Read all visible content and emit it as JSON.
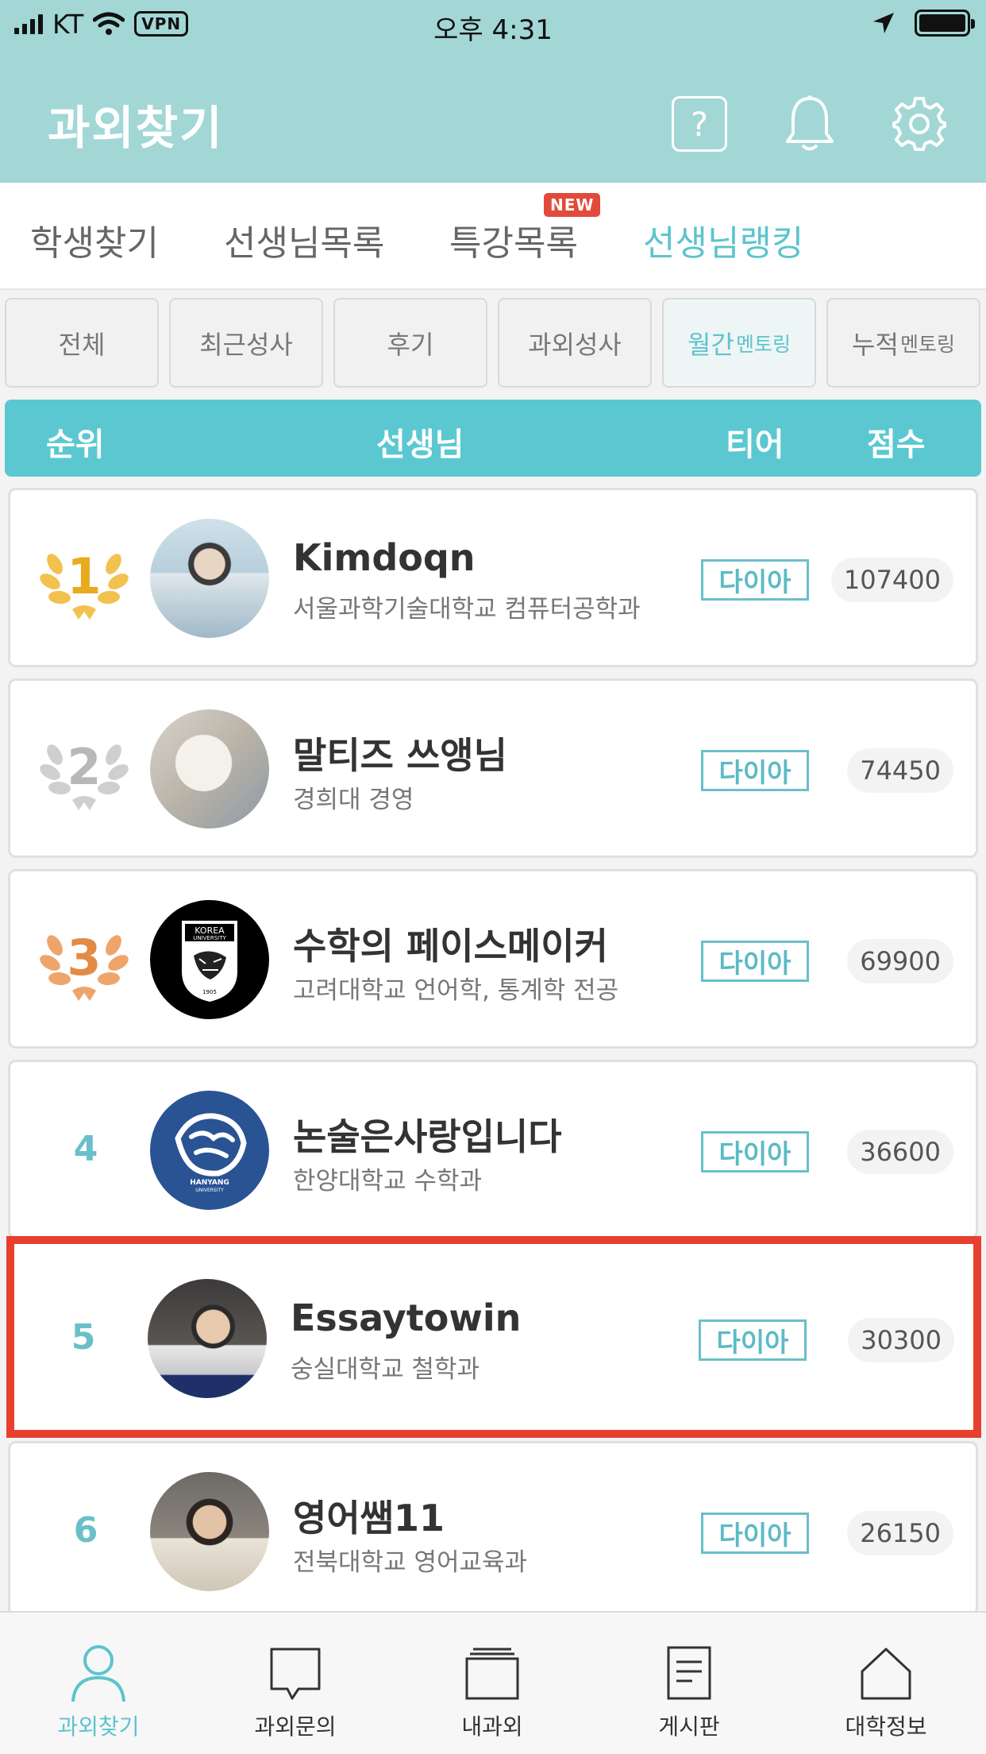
{
  "status_bar": {
    "carrier": "KT",
    "vpn": "VPN",
    "time": "오후 4:31"
  },
  "header": {
    "title": "과외찾기",
    "help_glyph": "?",
    "icons": [
      "help-icon",
      "bell-icon",
      "gear-icon"
    ]
  },
  "tabs": [
    {
      "label": "학생찾기"
    },
    {
      "label": "선생님목록"
    },
    {
      "label": "특강목록",
      "badge": "NEW"
    },
    {
      "label": "선생님랭킹",
      "active": true
    }
  ],
  "filters": [
    {
      "label": "전체",
      "suffix": ""
    },
    {
      "label": "최근성사",
      "suffix": ""
    },
    {
      "label": "후기",
      "suffix": ""
    },
    {
      "label": "과외성사",
      "suffix": ""
    },
    {
      "label": "월간",
      "suffix": "멘토링",
      "active": true
    },
    {
      "label": "누적",
      "suffix": "멘토링"
    }
  ],
  "ranking_header": {
    "rank": "순위",
    "teacher": "선생님",
    "tier": "티어",
    "score": "점수"
  },
  "rows": [
    {
      "rank": "1",
      "medal": "gold",
      "name": "Kimdoqn",
      "school": "서울과학기술대학교 컴퓨터공학과",
      "tier": "다이아",
      "score": "107400"
    },
    {
      "rank": "2",
      "medal": "silver",
      "name": "말티즈 쓰앵님",
      "school": "경희대 경영",
      "tier": "다이아",
      "score": "74450"
    },
    {
      "rank": "3",
      "medal": "bronze",
      "name": "수학의 페이스메이커",
      "school": "고려대학교 언어학, 통계학 전공",
      "tier": "다이아",
      "score": "69900"
    },
    {
      "rank": "4",
      "name": "논술은사랑입니다",
      "school": "한양대학교 수학과",
      "tier": "다이아",
      "score": "36600"
    },
    {
      "rank": "5",
      "name": "Essaytowin",
      "school": "숭실대학교 철학과",
      "tier": "다이아",
      "score": "30300",
      "highlighted": true
    },
    {
      "rank": "6",
      "name": "영어쌤11",
      "school": "전북대학교 영어교육과",
      "tier": "다이아",
      "score": "26150"
    }
  ],
  "logos": {
    "korea_text_1": "KOREA",
    "korea_text_2": "UNIVERSITY",
    "korea_year": "1905",
    "hanyang_text_1": "HANYANG",
    "hanyang_text_2": "UNIVERSITY"
  },
  "bottom_nav": [
    {
      "label": "과외찾기",
      "icon": "person-icon",
      "active": true
    },
    {
      "label": "과외문의",
      "icon": "chat-bubble-icon"
    },
    {
      "label": "내과외",
      "icon": "folder-stack-icon"
    },
    {
      "label": "게시판",
      "icon": "document-icon"
    },
    {
      "label": "대학정보",
      "icon": "home-icon"
    }
  ],
  "colors": {
    "header_bg": "#a2d7d6",
    "accent": "#5cc4ce",
    "ranking_bar": "#5bc8d1",
    "highlight_border": "#e8402f",
    "new_badge": "#e24a3b"
  }
}
